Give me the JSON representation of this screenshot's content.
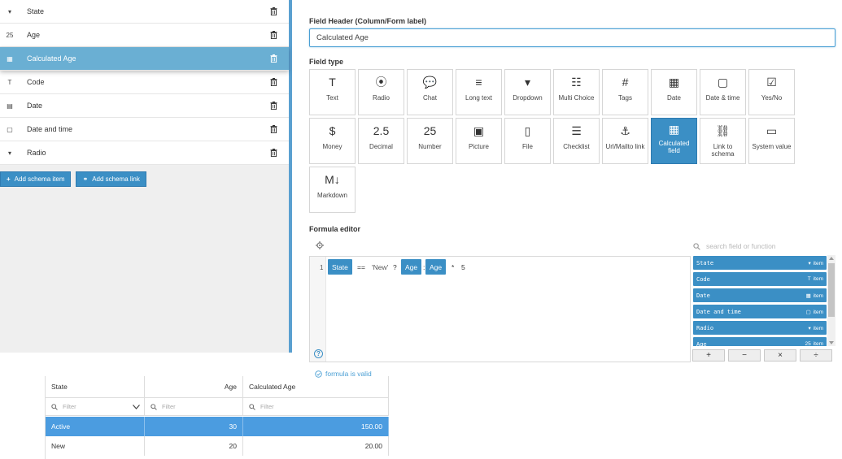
{
  "schema": {
    "items": [
      {
        "icon": "dropdown-icon",
        "glyph": "▾",
        "label": "State"
      },
      {
        "icon": "number-icon",
        "glyph": "25",
        "label": "Age"
      },
      {
        "icon": "calculated-icon",
        "glyph": "▦",
        "label": "Calculated Age",
        "selected": true
      },
      {
        "icon": "text-icon",
        "glyph": "T",
        "label": "Code"
      },
      {
        "icon": "date-icon",
        "glyph": "▤",
        "label": "Date"
      },
      {
        "icon": "datetime-icon",
        "glyph": "▢",
        "label": "Date and time"
      },
      {
        "icon": "radio-icon",
        "glyph": "▾",
        "label": "Radio"
      }
    ],
    "add_item_label": "Add schema item",
    "add_link_label": "Add schema link"
  },
  "field": {
    "header_label": "Field Header (Column/Form label)",
    "header_value": "Calculated Age",
    "type_label": "Field type",
    "types": [
      {
        "icon": "text-icon",
        "glyph": "T",
        "label": "Text"
      },
      {
        "icon": "radio-icon",
        "glyph": "⦿",
        "label": "Radio"
      },
      {
        "icon": "chat-icon",
        "glyph": "💬",
        "label": "Chat"
      },
      {
        "icon": "long-text-icon",
        "glyph": "≡",
        "label": "Long text"
      },
      {
        "icon": "dropdown-icon",
        "glyph": "▾",
        "label": "Dropdown"
      },
      {
        "icon": "multi-choice-icon",
        "glyph": "☷",
        "label": "Multi Choice"
      },
      {
        "icon": "tags-icon",
        "glyph": "#",
        "label": "Tags"
      },
      {
        "icon": "date-icon",
        "glyph": "▦",
        "label": "Date"
      },
      {
        "icon": "date-time-icon",
        "glyph": "▢",
        "label": "Date & time"
      },
      {
        "icon": "yes-no-icon",
        "glyph": "☑",
        "label": "Yes/No"
      },
      {
        "icon": "money-icon",
        "glyph": "$",
        "label": "Money"
      },
      {
        "icon": "decimal-icon",
        "glyph": "2.5",
        "label": "Decimal"
      },
      {
        "icon": "number-icon",
        "glyph": "25",
        "label": "Number"
      },
      {
        "icon": "picture-icon",
        "glyph": "▣",
        "label": "Picture"
      },
      {
        "icon": "file-icon",
        "glyph": "▯",
        "label": "File"
      },
      {
        "icon": "checklist-icon",
        "glyph": "☰",
        "label": "Checklist"
      },
      {
        "icon": "anchor-icon",
        "glyph": "⚓",
        "label": "Url/Mailto link"
      },
      {
        "icon": "calculated-field-icon",
        "glyph": "▦",
        "label": "Calculated field",
        "active": true
      },
      {
        "icon": "link-icon",
        "glyph": "⛓",
        "label": "Link to schema"
      },
      {
        "icon": "system-value-icon",
        "glyph": "▭",
        "label": "System value"
      },
      {
        "icon": "markdown-icon",
        "glyph": "M↓",
        "label": "Markdown"
      }
    ]
  },
  "formula": {
    "label": "Formula editor",
    "line_number": "1",
    "tokens": [
      {
        "kind": "field",
        "text": "State"
      },
      {
        "kind": "op",
        "text": "=="
      },
      {
        "kind": "str",
        "text": "'New'"
      },
      {
        "kind": "op",
        "text": "?"
      },
      {
        "kind": "field",
        "text": "Age"
      },
      {
        "kind": "op",
        "text": ":"
      },
      {
        "kind": "field",
        "text": "Age"
      },
      {
        "kind": "op",
        "text": "*"
      },
      {
        "kind": "op",
        "text": "5"
      }
    ],
    "search_placeholder": "search field or function",
    "fields": [
      {
        "name": "State",
        "type": "item",
        "glyph": "▾"
      },
      {
        "name": "Code",
        "type": "item",
        "glyph": "T"
      },
      {
        "name": "Date",
        "type": "item",
        "glyph": "▦"
      },
      {
        "name": "Date and time",
        "type": "item",
        "glyph": "▢"
      },
      {
        "name": "Radio",
        "type": "item",
        "glyph": "▾"
      },
      {
        "name": "Age",
        "type": "item",
        "glyph": "25"
      }
    ],
    "operators": [
      "+",
      "−",
      "×",
      "÷"
    ],
    "valid_text": "formula is valid"
  },
  "grid": {
    "columns": [
      "State",
      "Age",
      "Calculated Age"
    ],
    "filter_placeholder": "Filter",
    "rows": [
      {
        "state": "Active",
        "age": "30",
        "calc": "150.00",
        "selected": true
      },
      {
        "state": "New",
        "age": "20",
        "calc": "20.00"
      }
    ]
  },
  "colors": {
    "accent": "#3b8fc5",
    "selected_row": "#6aafd3",
    "grid_selected": "#4b9ce0"
  }
}
